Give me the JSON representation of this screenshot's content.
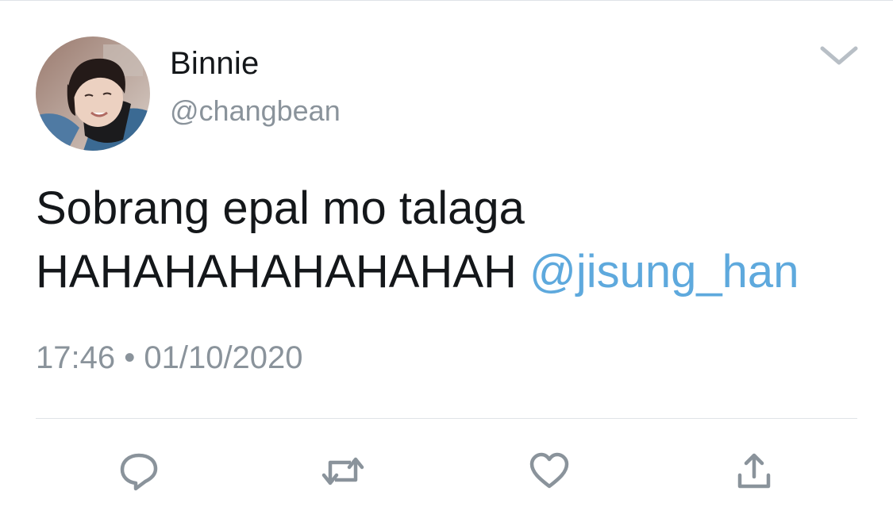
{
  "author": {
    "display_name": "Binnie",
    "handle": "@changbean"
  },
  "tweet": {
    "line1": "Sobrang epal mo talaga",
    "line2_text": "HAHAHAHAHAHAHAH ",
    "mention": "@jisung_han"
  },
  "meta": {
    "time": "17:46",
    "separator": " • ",
    "date": "01/10/2020"
  },
  "actions": {
    "reply_icon": "reply-icon",
    "retweet_icon": "retweet-icon",
    "like_icon": "heart-icon",
    "share_icon": "share-icon"
  },
  "colors": {
    "text": "#14171a",
    "secondary": "#8a939b",
    "mention": "#5ea9dd",
    "icon": "#8a939b",
    "divider": "#dfe3e7"
  }
}
